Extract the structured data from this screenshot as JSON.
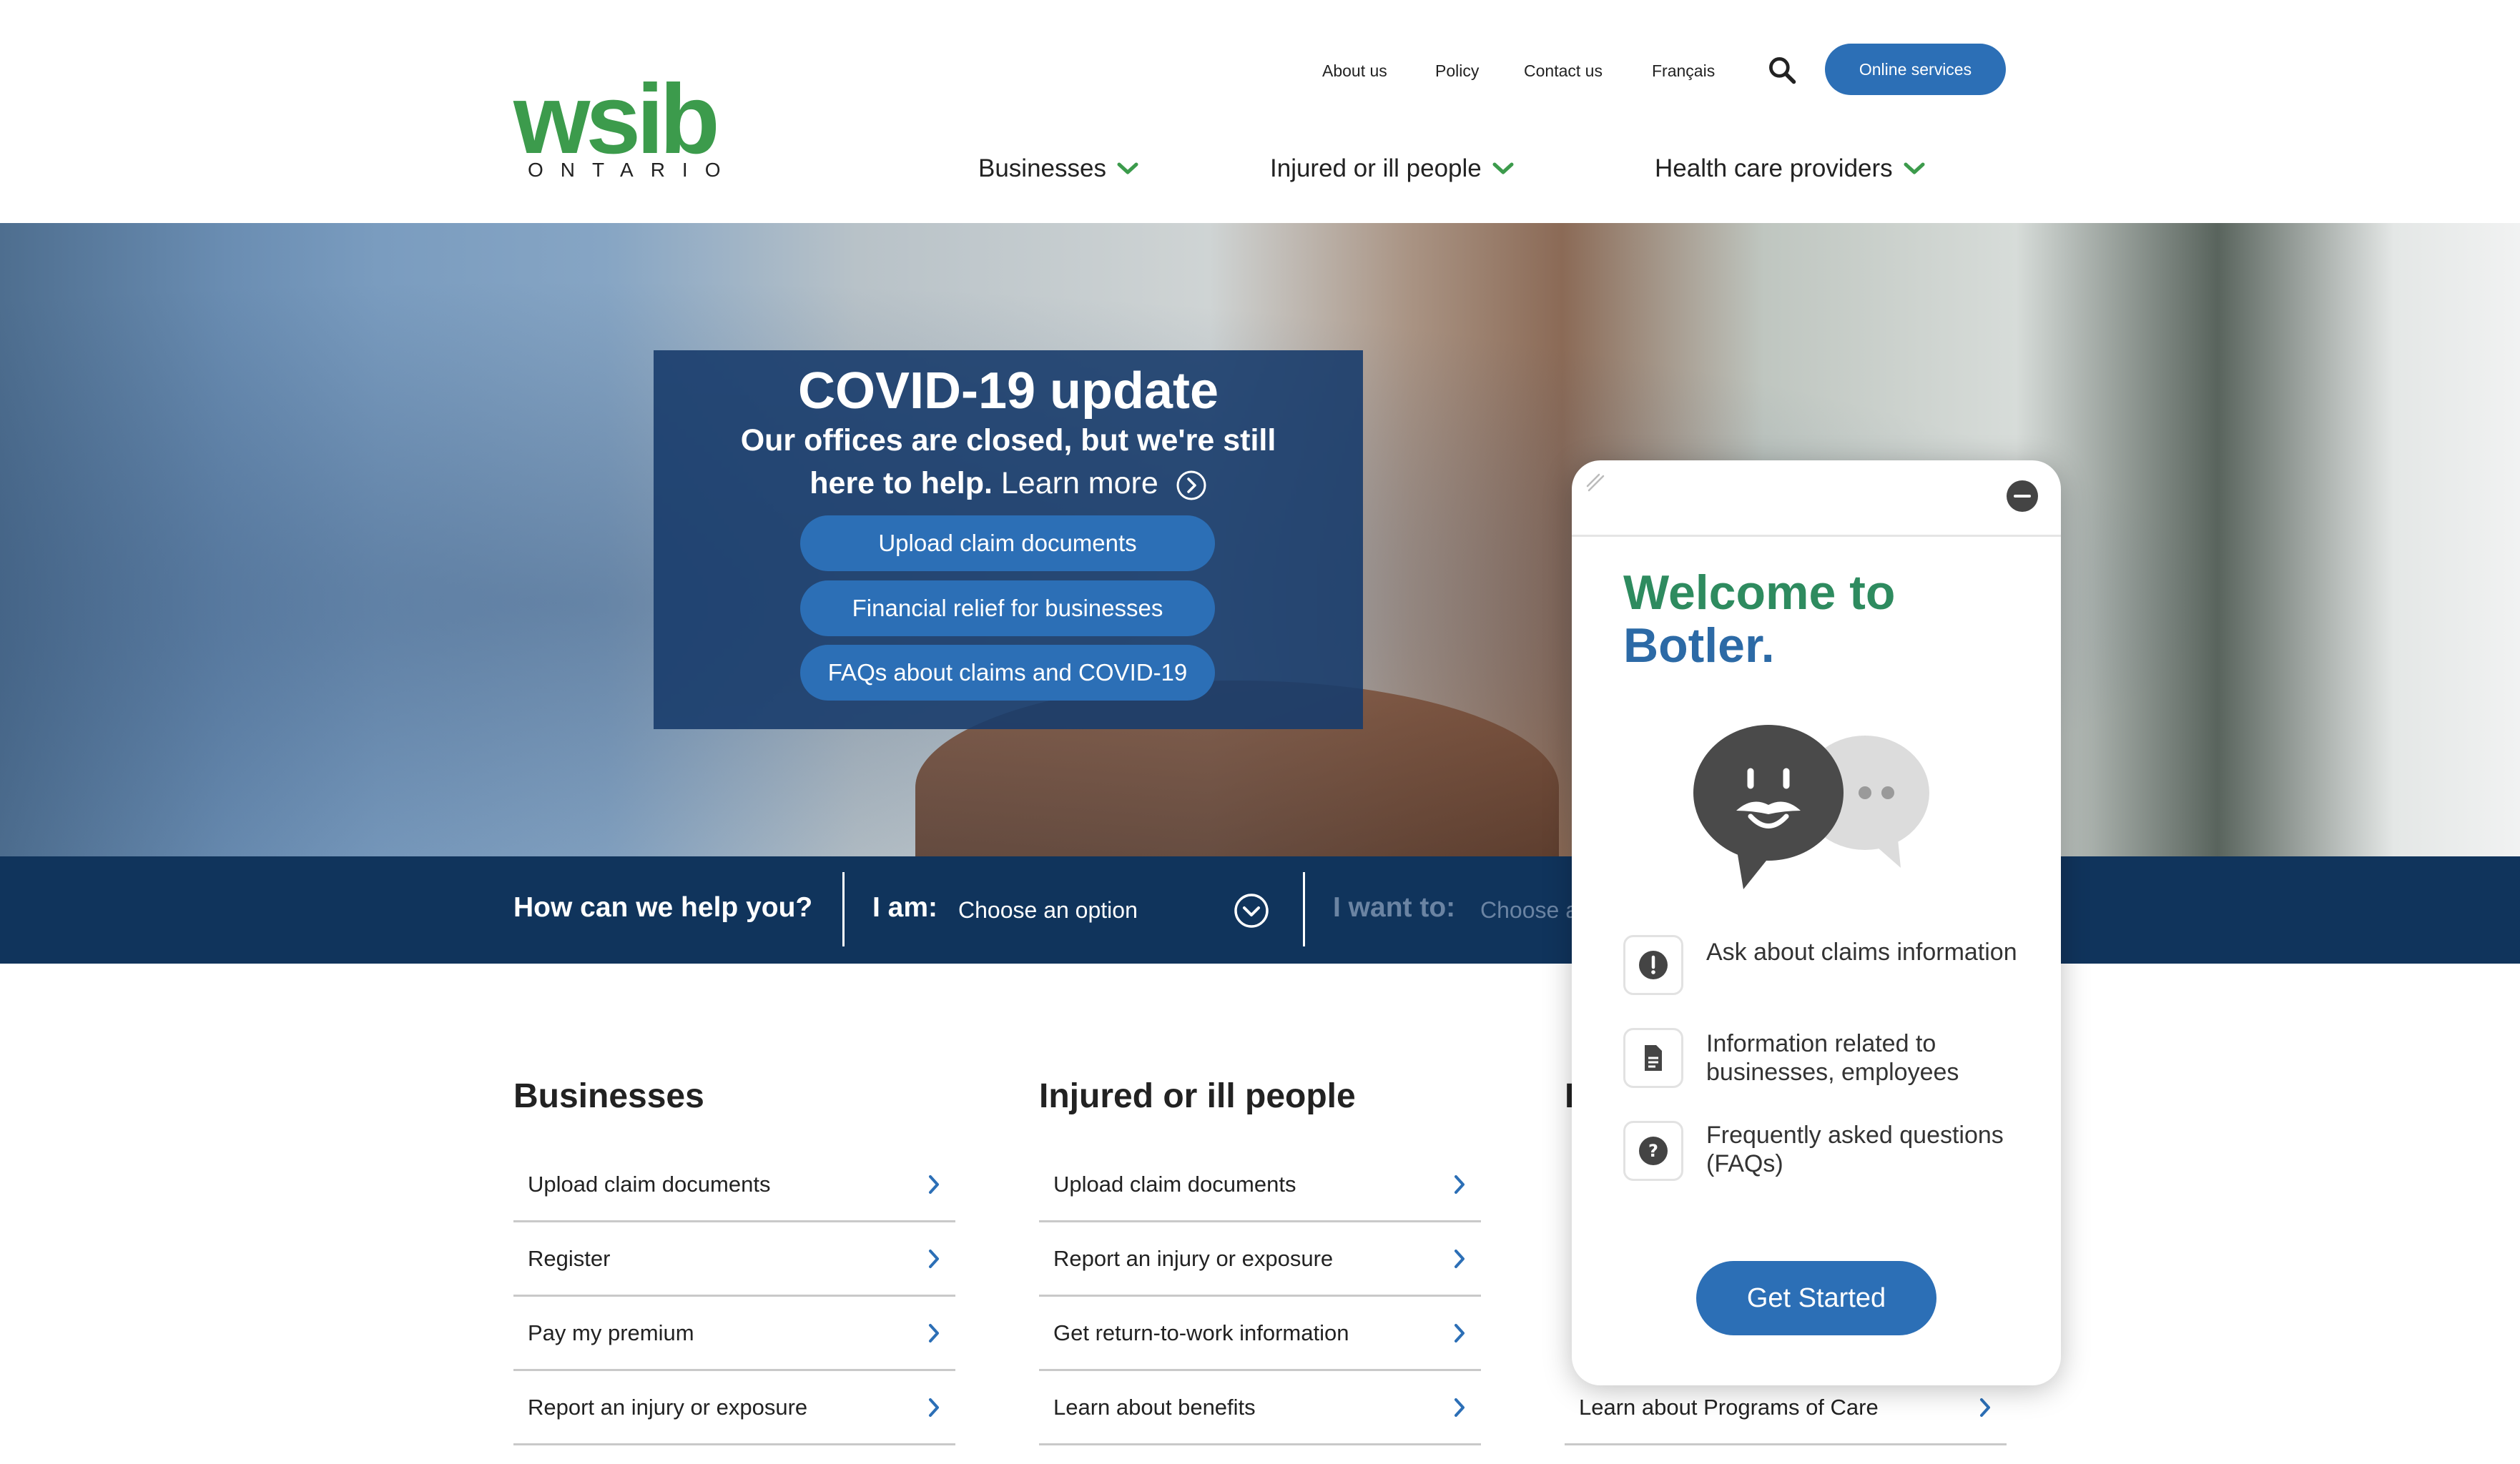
{
  "header": {
    "logo": {
      "wordmark": "wsib",
      "subtitle": "ONTARIO"
    },
    "utility_links": [
      "About us",
      "Policy",
      "Contact us",
      "Français"
    ],
    "online_services": "Online services",
    "main_nav": [
      "Businesses",
      "Injured or ill people",
      "Health care providers"
    ]
  },
  "hero": {
    "title": "COVID-19 update",
    "subtitle_line1": "Our offices are closed, but we're still",
    "subtitle_line2": "here to help.",
    "learn_more": "Learn more",
    "buttons": [
      "Upload claim documents",
      "Financial relief for businesses",
      "FAQs about claims and COVID-19"
    ]
  },
  "help_bar": {
    "question": "How can we help you?",
    "i_am_label": "I am:",
    "i_am_value": "Choose an option",
    "i_want_label": "I want to:",
    "i_want_value": "Choose a"
  },
  "columns": [
    {
      "title": "Businesses",
      "items": [
        "Upload claim documents",
        "Register",
        "Pay my premium",
        "Report an injury or exposure"
      ]
    },
    {
      "title": "Injured or ill people",
      "items": [
        "Upload claim documents",
        "Report an injury or exposure",
        "Get return-to-work information",
        "Learn about benefits"
      ]
    },
    {
      "title": "I",
      "items": [
        "Learn about Programs of Care"
      ]
    }
  ],
  "chat": {
    "welcome_line1": "Welcome to",
    "welcome_line2": "Botler.",
    "features": [
      {
        "icon": "exclamation-icon",
        "text": "Ask about claims information"
      },
      {
        "icon": "document-icon",
        "text": "Information related to businesses, employees"
      },
      {
        "icon": "question-icon",
        "text": "Frequently asked questions (FAQs)"
      }
    ],
    "get_started": "Get Started"
  },
  "colors": {
    "brand_green": "#3c9b4c",
    "brand_blue": "#2c6fb6",
    "navy": "#10345c"
  }
}
